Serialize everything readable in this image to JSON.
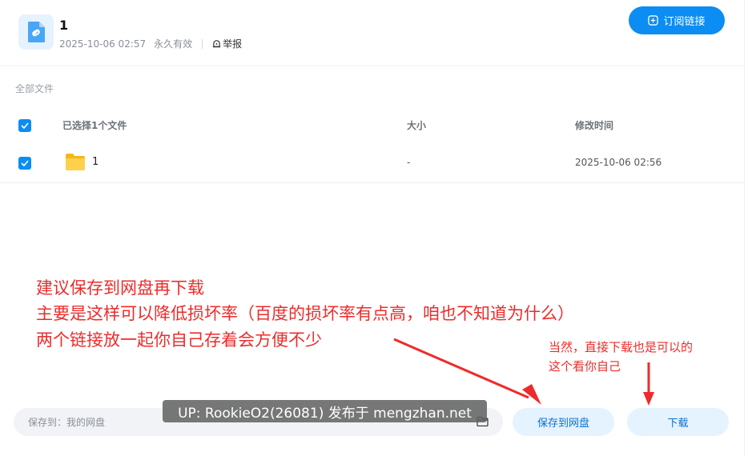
{
  "share": {
    "title": "1",
    "date": "2025-10-06 02:57",
    "validity": "永久有效",
    "report_label": "举报"
  },
  "header": {
    "subscribe_label": "订阅链接"
  },
  "breadcrumb": "全部文件",
  "table": {
    "columns": [
      "已选择1个文件",
      "大小",
      "修改时间"
    ],
    "rows": [
      {
        "name": "1",
        "size": "-",
        "modified": "2025-10-06 02:56",
        "checked": true
      }
    ]
  },
  "annotations": {
    "main": [
      "建议保存到网盘再下载",
      "主要是这样可以降低损坏率（百度的损坏率有点高，咱也不知道为什么）",
      "两个链接放一起你自己存着会方便不少"
    ],
    "side": [
      "当然，直接下载也是可以的",
      "这个看你自己"
    ],
    "color": "#ee2b2b"
  },
  "footer": {
    "save_path_label": "保存到：我的网盘",
    "save_button": "保存到网盘",
    "download_button": "下载"
  },
  "watermark": "UP: RookieO2(26081) 发布于 mengzhan.net",
  "colors": {
    "accent": "#0b8df3",
    "button_light": "#e5f3fe"
  }
}
